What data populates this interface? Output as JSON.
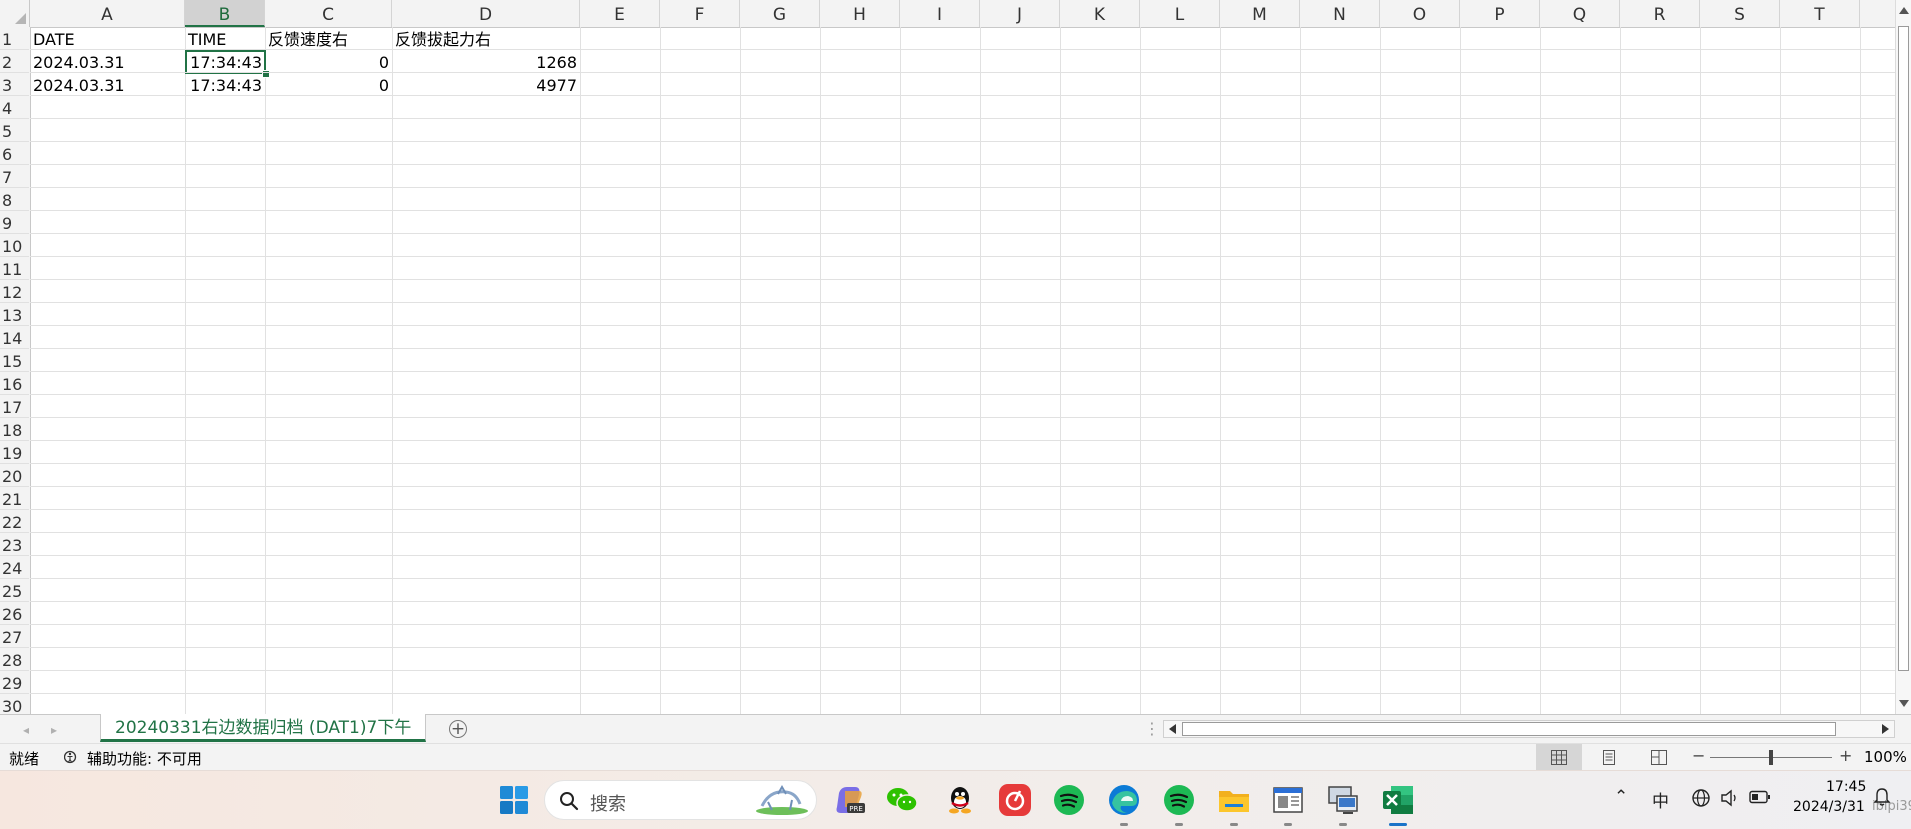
{
  "columns": [
    "A",
    "B",
    "C",
    "D",
    "E",
    "F",
    "G",
    "H",
    "I",
    "J",
    "K",
    "L",
    "M",
    "N",
    "O",
    "P",
    "Q",
    "R",
    "S",
    "T"
  ],
  "selected_column": "B",
  "rows": [
    "1",
    "2",
    "3",
    "4",
    "5",
    "6",
    "7",
    "8",
    "9",
    "10",
    "11",
    "12",
    "13",
    "14",
    "15",
    "16",
    "17",
    "18",
    "19",
    "20",
    "21",
    "22",
    "23",
    "24",
    "25",
    "26",
    "27",
    "28",
    "29",
    "30"
  ],
  "cells": {
    "A1": "DATE",
    "B1": "TIME",
    "C1": "反馈速度右",
    "D1": "反馈拔起力右",
    "A2": "2024.03.31",
    "B2": "17:34:43",
    "C2": "0",
    "D2": "1268",
    "A3": "2024.03.31",
    "B3": "17:34:43",
    "C3": "0",
    "D3": "4977"
  },
  "sheet_tab": {
    "label": "20240331右边数据归档 (DAT1)7下午"
  },
  "status": {
    "ready": "就绪",
    "accessibility": "辅助功能: 不可用"
  },
  "zoom": {
    "level": "100%",
    "minus": "−",
    "plus": "+"
  },
  "taskbar": {
    "search_label": "搜索",
    "apps": [
      "start-icon",
      "copilot-icon",
      "wechat-icon",
      "qq-icon",
      "netease-music-icon",
      "spotify-icon",
      "edge-icon",
      "spotify-icon",
      "file-explorer-icon",
      "window-app-icon",
      "remote-desktop-icon",
      "excel-icon"
    ],
    "tray_ime": "中",
    "time": "17:45",
    "date": "2024/3/31",
    "watermark": "ibipi39"
  },
  "colors": {
    "excel_green": "#217346",
    "grid_line": "#e1e1e1",
    "header_bg": "#f3f3f3"
  }
}
